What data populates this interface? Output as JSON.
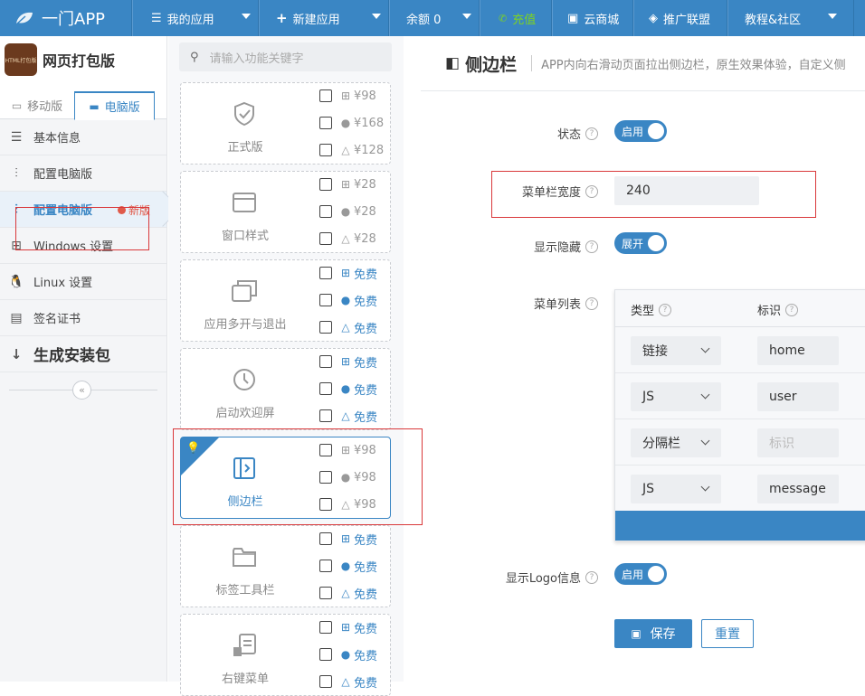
{
  "header": {
    "logo_text": "一门APP",
    "nav": [
      {
        "icon": "menu-icon",
        "label": "我的应用",
        "caret": true
      },
      {
        "icon": "plus-icon",
        "label": "新建应用",
        "caret": true
      },
      {
        "label": "余额 0",
        "caret": true
      },
      {
        "icon": "wechat-icon",
        "label": "充值"
      },
      {
        "icon": "shop-icon",
        "label": "云商城"
      },
      {
        "icon": "diamond-icon",
        "label": "推广联盟"
      },
      {
        "label": "教程&社区",
        "caret": true
      }
    ],
    "recharge_color": "#7ed321"
  },
  "sidebar": {
    "app_icon_text": "HTML打包版",
    "app_name": "网页打包版",
    "tabs": [
      {
        "label": "移动版",
        "icon": "mobile-icon",
        "active": false
      },
      {
        "label": "电脑版",
        "icon": "monitor-icon",
        "active": true
      }
    ],
    "items": [
      {
        "label": "基本信息",
        "icon": "info-icon"
      },
      {
        "label": "配置电脑版",
        "icon": "sliders-icon"
      },
      {
        "label": "配置电脑版",
        "icon": "sliders-icon",
        "active": true,
        "badge": "新版"
      },
      {
        "label": "Windows 设置",
        "icon": "windows-icon"
      },
      {
        "label": "Linux 设置",
        "icon": "linux-icon"
      },
      {
        "label": "签名证书",
        "icon": "certificate-icon"
      },
      {
        "label": "生成安装包",
        "icon": "build-icon",
        "big": true
      }
    ],
    "collapse_icon": "double-chevron-left-icon"
  },
  "features": {
    "search_placeholder": "请输入功能关键字",
    "cards": [
      {
        "label": "正式版",
        "icon": "shield-check-icon",
        "prices": [
          "¥98",
          "¥168",
          "¥128"
        ],
        "free": false
      },
      {
        "label": "窗口样式",
        "icon": "window-icon",
        "prices": [
          "¥28",
          "¥28",
          "¥28"
        ],
        "free": false
      },
      {
        "label": "应用多开与退出",
        "icon": "multi-window-icon",
        "prices": [
          "免费",
          "免费",
          "免费"
        ],
        "free": true
      },
      {
        "label": "启动欢迎屏",
        "icon": "clock-icon",
        "prices": [
          "免费",
          "免费",
          "免费"
        ],
        "free": true
      },
      {
        "label": "侧边栏",
        "icon": "sidebar-panel-icon",
        "prices": [
          "¥98",
          "¥98",
          "¥98"
        ],
        "free": false,
        "selected": true
      },
      {
        "label": "标签工具栏",
        "icon": "tabs-icon",
        "prices": [
          "免费",
          "免费",
          "免费"
        ],
        "free": true
      },
      {
        "label": "右键菜单",
        "icon": "context-menu-icon",
        "prices": [
          "免费",
          "免费",
          "免费"
        ],
        "free": true
      }
    ]
  },
  "main": {
    "title": "侧边栏",
    "description": "APP内向右滑动页面拉出侧边栏，原生效果体验，自定义侧",
    "fields": {
      "status_label": "状态",
      "status_toggle": "启用",
      "width_label": "菜单栏宽度",
      "width_value": "240",
      "show_hide_label": "显示隐藏",
      "show_hide_toggle": "展开",
      "menu_list_label": "菜单列表",
      "logo_label": "显示Logo信息",
      "logo_toggle": "启用"
    },
    "menu_table": {
      "col_type": "类型",
      "col_id": "标识",
      "rows": [
        {
          "type": "链接",
          "id": "home",
          "placeholder": false
        },
        {
          "type": "JS",
          "id": "user",
          "placeholder": false
        },
        {
          "type": "分隔栏",
          "id": "标识",
          "placeholder": true
        },
        {
          "type": "JS",
          "id": "message",
          "placeholder": false
        }
      ]
    },
    "save_label": "保存",
    "reset_label": "重置"
  },
  "accent_color": "#3a86c4",
  "highlight_color": "#d9383a"
}
